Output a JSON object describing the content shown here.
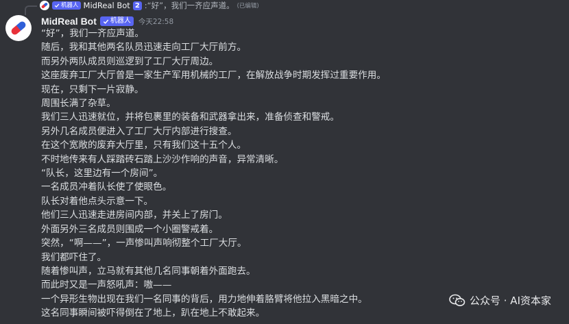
{
  "reply": {
    "bot_tag": "机器人",
    "author": "MidReal Bot",
    "count_badge": "2",
    "text": ":“好”，我们一齐应声道。",
    "edited": "(已编辑)"
  },
  "message": {
    "author": "MidReal Bot",
    "bot_tag": "机器人",
    "timestamp": "今天22:58",
    "lines": [
      "“好”，我们一齐应声道。",
      "随后，我和其他两名队员迅速走向工厂大厅前方。",
      "而另外两队成员则巡逻到了工厂大厅周边。",
      "这座废弃工厂大厅曾是一家生产军用机械的工厂，在解放战争时期发挥过重要作用。",
      "现在，只剩下一片寂静。",
      "周围长满了杂草。",
      "我们三人迅速就位，并将包裹里的装备和武器拿出来，准备侦查和警戒。",
      "另外几名成员便进入了工厂大厅内部进行搜查。",
      "在这个宽敞的废弃大厅里，只有我们这十五个人。",
      "不时地传来有人踩踏砖石踏上沙沙作响的声音，异常清晰。",
      "“队长，这里边有一个房间”。",
      "一名成员冲着队长使了使眼色。",
      "队长对着他点头示意一下。",
      "他们三人迅速走进房间内部，并关上了房门。",
      "外面另外三名成员则围成一个小圈警戒着。",
      "突然，“啊——”，一声惨叫声响彻整个工厂大厅。",
      "我们都吓住了。",
      "随着惨叫声，立马就有其他几名同事朝着外面跑去。",
      "而此时又是一声怒吼声：嗷——",
      "一个异形生物出现在我们一名同事的背后，用力地伸着胳臂将他拉入黑暗之中。",
      "这名同事瞬间被吓得倒在了地上，趴在地上不敢起来。"
    ]
  },
  "watermark": {
    "text": "公众号 · AI资本家",
    "icon": "wechat-icon"
  },
  "colors": {
    "background": "#313338",
    "bot_tag": "#5865f2",
    "text": "#dbdee1",
    "muted": "#949ba4"
  }
}
